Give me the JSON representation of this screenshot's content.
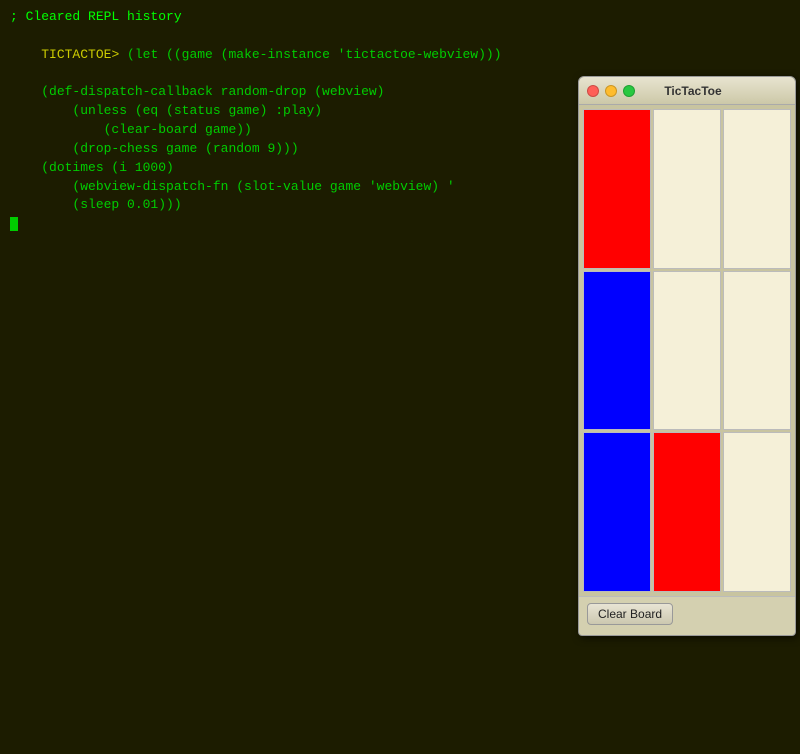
{
  "terminal": {
    "cleared_line": "; Cleared REPL history",
    "prompt_name": "TICTACTOE",
    "prompt_symbol": "> ",
    "code_lines": [
      "(let ((game (make-instance 'tictactoe-webview)))",
      "  (def-dispatch-callback random-drop (webview)",
      "    (unless (eq (status game) :play)",
      "      (clear-board game))",
      "    (drop-chess game (random 9)))",
      "  (dotimes (i 1000)",
      "    (webview-dispatch-fn (slot-value game 'webview) '",
      "    (sleep 0.01)))"
    ]
  },
  "tictactoe_window": {
    "title": "TicTacToe",
    "board": [
      [
        "red",
        "empty",
        "empty"
      ],
      [
        "blue",
        "empty",
        "empty"
      ],
      [
        "blue",
        "red",
        "empty"
      ]
    ],
    "clear_board_label": "Clear Board",
    "traffic_lights": {
      "close": "close",
      "minimize": "minimize",
      "maximize": "maximize"
    }
  }
}
